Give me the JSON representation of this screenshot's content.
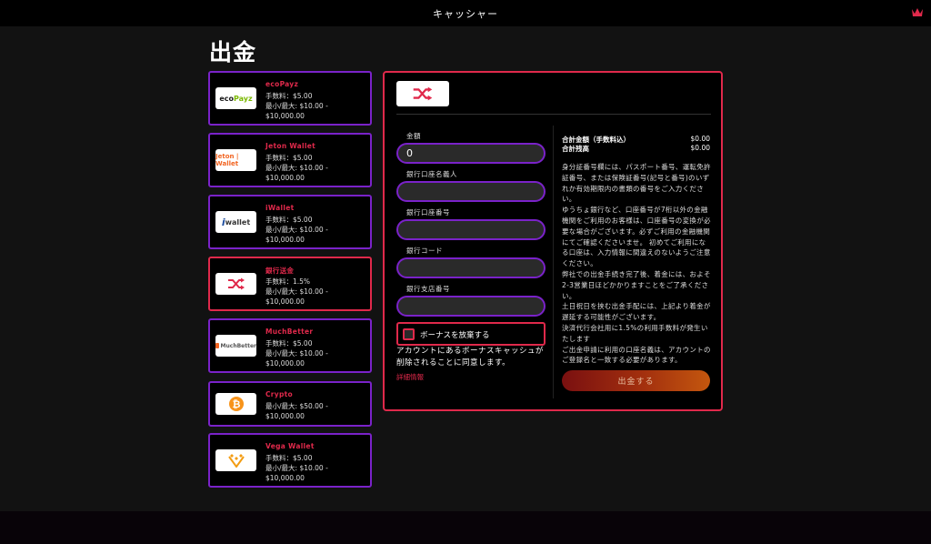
{
  "header": {
    "title": "キャッシャー",
    "logo_icon": "crown-icon",
    "logo_color": "#e0294b"
  },
  "page": {
    "title": "出金"
  },
  "methods": [
    {
      "name": "ecoPayz",
      "fee": "手数料：$5.00",
      "limit": "最小/最大: $10.00 - $10,000.00",
      "logo_text": "ecoPayz",
      "logo_icon": "ecopayz-logo-icon"
    },
    {
      "name": "Jeton Wallet",
      "fee": "手数料：$5.00",
      "limit": "最小/最大: $10.00 - $10,000.00",
      "logo_text": "Jeton | Wallet",
      "logo_icon": "jeton-logo-icon"
    },
    {
      "name": "iWallet",
      "fee": "手数料：$5.00",
      "limit": "最小/最大: $10.00 - $10,000.00",
      "logo_text": "wallet",
      "logo_icon": "iwallet-logo-icon"
    },
    {
      "name": "銀行送金",
      "fee": "手数料：1.5%",
      "limit": "最小/最大: $10.00 - $10,000.00",
      "logo_text": "",
      "logo_icon": "bank-transfer-icon"
    },
    {
      "name": "MuchBetter",
      "fee": "手数料：$5.00",
      "limit": "最小/最大: $10.00 - $10,000.00",
      "logo_text": "MuchBetter",
      "logo_icon": "muchbetter-logo-icon"
    },
    {
      "name": "Crypto",
      "fee": "最小/最大: $50.00 -",
      "limit": "$10,000.00",
      "logo_text": "",
      "logo_icon": "bitcoin-icon"
    },
    {
      "name": "Vega Wallet",
      "fee": "手数料：$5.00",
      "limit": "最小/最大: $10.00 - $10,000.00",
      "logo_text": "",
      "logo_icon": "vega-logo-icon"
    }
  ],
  "form": {
    "selected_icon": "bank-transfer-icon",
    "amount_label": "金額",
    "amount_value": "0",
    "holder_label": "銀行口座名義人",
    "account_label": "銀行口座番号",
    "code_label": "銀行コード",
    "branch_label": "銀行支店番号",
    "bonus_checkbox_label": "ボーナスを放棄する",
    "bonus_note": "アカウントにあるボーナスキャッシュが削除されることに同意します。",
    "details_link": "詳細情報"
  },
  "summary": {
    "total_label": "合計金額（手数料込）",
    "total_value": "$0.00",
    "balance_label": "合計残高",
    "balance_value": "$0.00",
    "info": [
      "身分証番号欄には、パスポート番号、運転免許証番号、または保険証番号(記号と番号)のいずれか有効期限内の書類の番号をご入力ください。",
      "ゆうちょ銀行など、口座番号が7桁以外の金融機関をご利用のお客様は、口座番号の変換が必要な場合がございます。必ずご利用の金融機関にてご確認くださいませ。 初めてご利用になる口座は、入力情報に間違えのないようご注意ください。",
      "弊社での出金手続き完了後、着金には、およそ2-3営業日ほどかかりますことをご了承ください。",
      "土日祝日を挟む出金手配には、上記より着金が遅延する可能性がございます。",
      "決済代行会社用に1.5%の利用手数料が発生いたします",
      "ご出金申請に利用の口座名義は、アカウントのご登録名と一致する必要があります。"
    ],
    "withdraw_button": "出金する"
  }
}
